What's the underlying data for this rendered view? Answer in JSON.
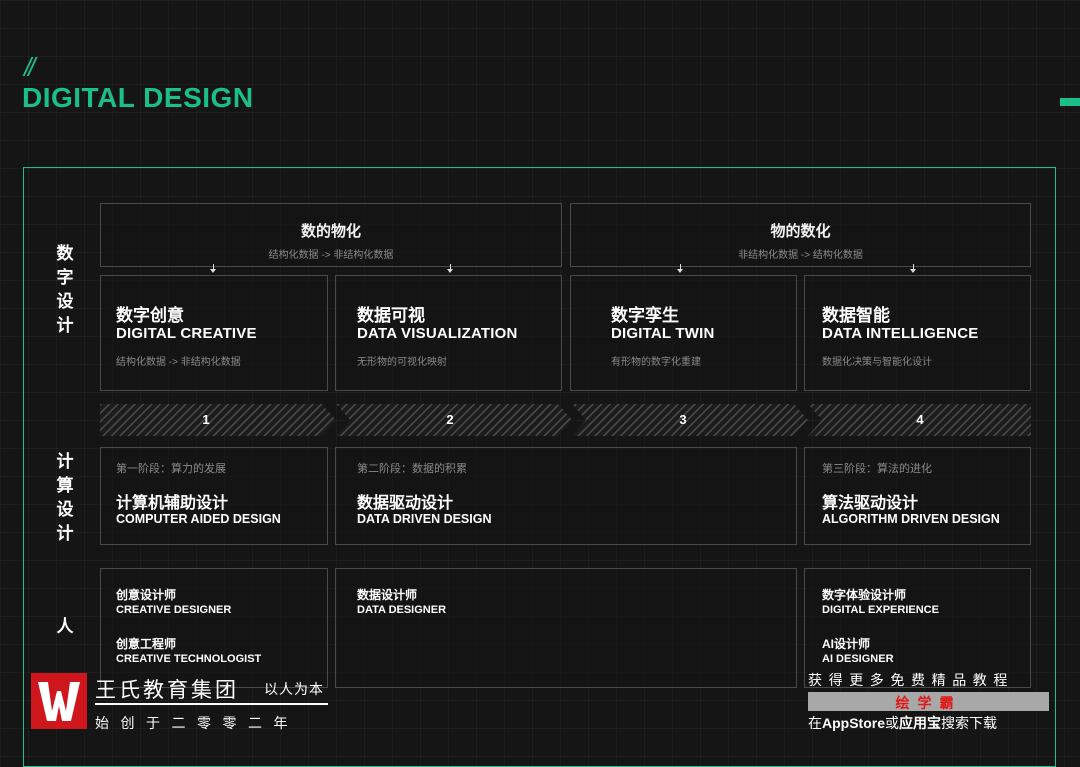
{
  "header": {
    "slashes": "//",
    "title": "DIGITAL DESIGN"
  },
  "row_labels": {
    "digital": [
      "数",
      "字",
      "设",
      "计"
    ],
    "computational": [
      "计",
      "算",
      "设",
      "计"
    ],
    "people": [
      "人"
    ]
  },
  "groups": [
    {
      "title": "数的物化",
      "subtitle": "结构化数据 -> 非结构化数据"
    },
    {
      "title": "物的数化",
      "subtitle": "非结构化数据 -> 结构化数据"
    }
  ],
  "digital_cards": [
    {
      "cn": "数字创意",
      "en": "DIGITAL CREATIVE",
      "sub": "结构化数据 -> 非结构化数据"
    },
    {
      "cn": "数据可视",
      "en": "DATA VISUALIZATION",
      "sub": "无形物的可视化映射"
    },
    {
      "cn": "数字孪生",
      "en": "DIGITAL TWIN",
      "sub": "有形物的数字化重建"
    },
    {
      "cn": "数据智能",
      "en": "DATA INTELLIGENCE",
      "sub": "数据化决策与智能化设计"
    }
  ],
  "steps": [
    "1",
    "2",
    "3",
    "4"
  ],
  "stages": [
    {
      "label": "第一阶段：算力的发展",
      "cn": "计算机辅助设计",
      "en": "COMPUTER AIDED DESIGN"
    },
    {
      "label": "第二阶段：数据的积累",
      "cn": "数据驱动设计",
      "en": "DATA DRIVEN DESIGN"
    },
    {
      "label": "第三阶段：算法的进化",
      "cn": "算法驱动设计",
      "en": "ALGORITHM DRIVEN DESIGN"
    }
  ],
  "people": [
    {
      "roles": [
        {
          "cn": "创意设计师",
          "en": "CREATIVE DESIGNER"
        },
        {
          "cn": "创意工程师",
          "en": "CREATIVE TECHNOLOGIST"
        }
      ]
    },
    {
      "roles": [
        {
          "cn": "数据设计师",
          "en": "DATA DESIGNER"
        }
      ]
    },
    {
      "roles": [
        {
          "cn": "数字体验设计师",
          "en": "DIGITAL EXPERIENCE"
        },
        {
          "cn": "AI设计师",
          "en": "AI DESIGNER"
        }
      ]
    }
  ],
  "watermark_left": {
    "name": "王氏教育集团",
    "slogan": "以人为本",
    "since": "始创于二零零二年"
  },
  "watermark_right": {
    "top": "获得更多免费精品教程",
    "brand": "绘学霸",
    "bottom_prefix": "在",
    "bottom_store1": "AppStore",
    "bottom_mid": "或",
    "bottom_store2": "应用宝",
    "bottom_suffix": "搜索下载"
  },
  "colors": {
    "accent": "#1bbf8a",
    "background": "#151515",
    "box_border": "#4a4a4a",
    "logo_red": "#d0161d"
  }
}
